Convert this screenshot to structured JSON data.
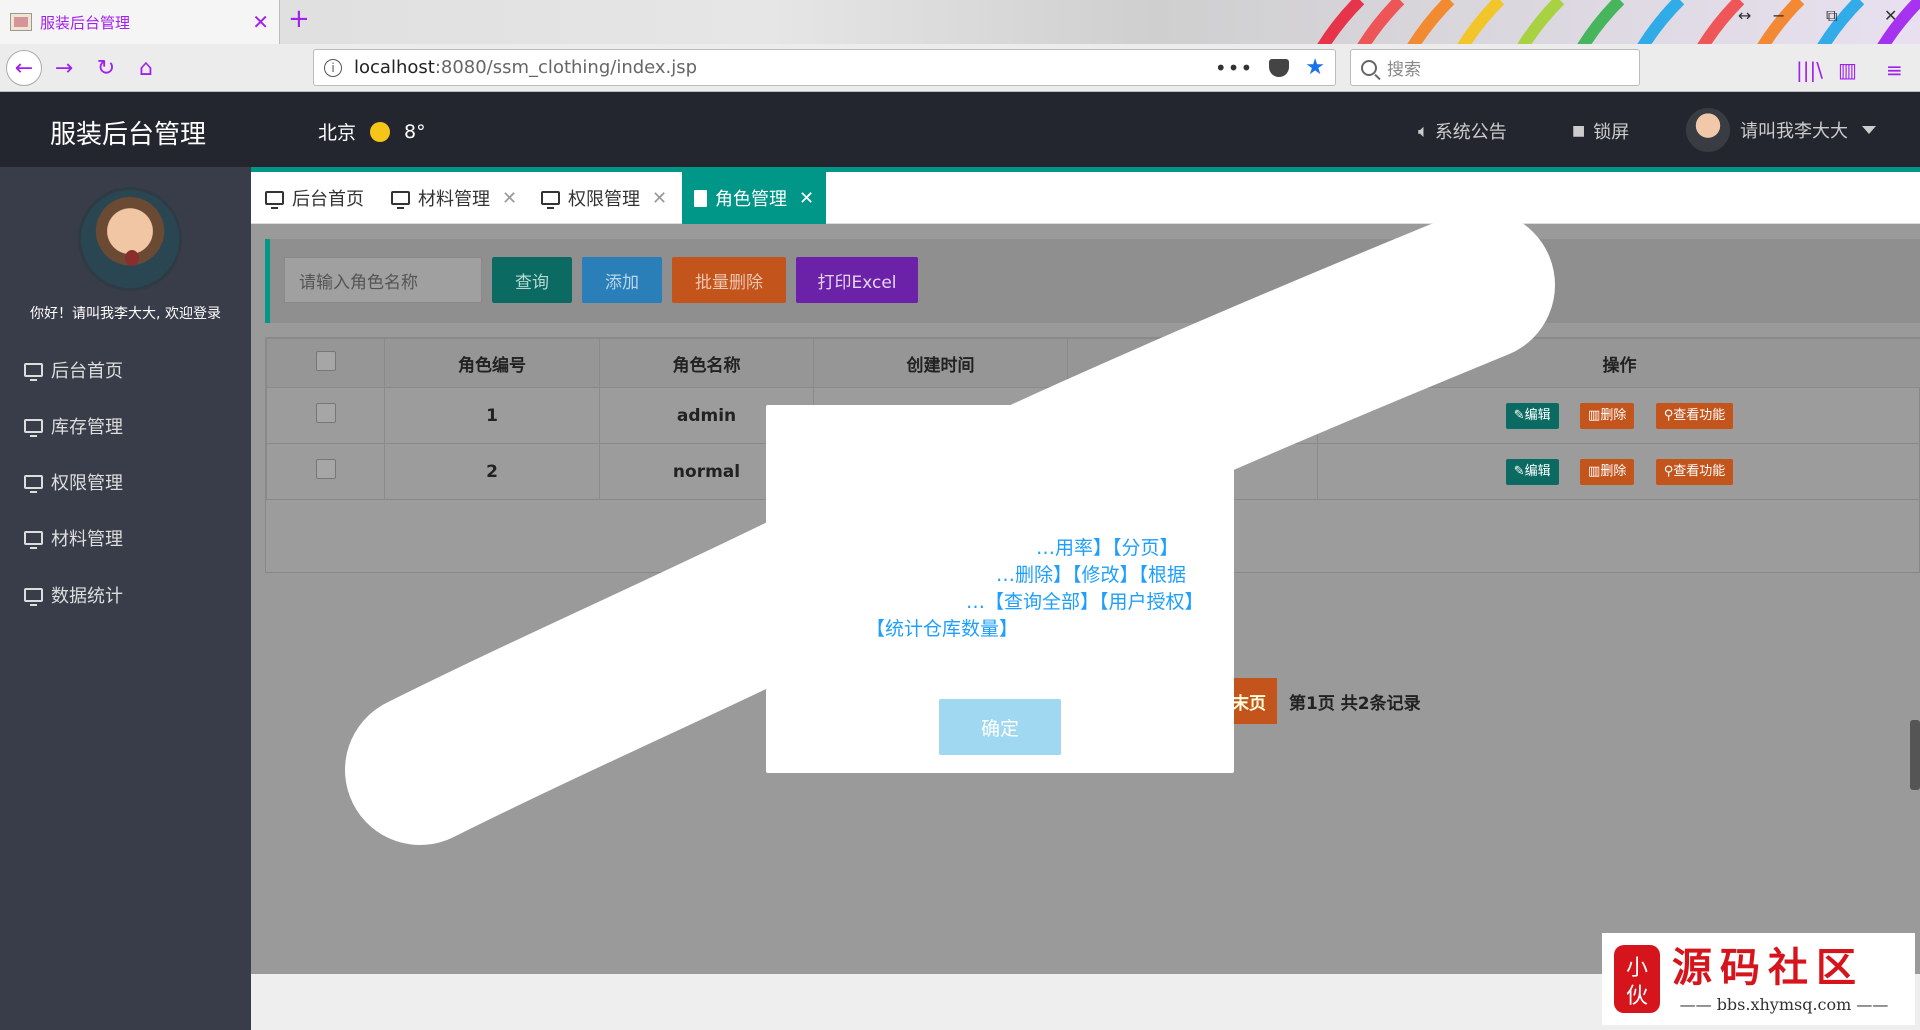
{
  "browser": {
    "tab_title": "服装后台管理",
    "tab_close": "✕",
    "new_tab": "+",
    "url_host": "localhost",
    "url_path": ":8080/ssm_clothing/index.jsp",
    "url_more": "•••",
    "search_placeholder": "搜索",
    "win_restore": "↔",
    "win_min": "−",
    "win_max": "⧉",
    "win_close": "✕"
  },
  "header": {
    "logo": "服装后台管理",
    "city": "北京",
    "temperature": "8°",
    "notice": "系统公告",
    "lock": "锁屏",
    "username": "请叫我李大大"
  },
  "sidebar": {
    "welcome": "你好！请叫我李大大, 欢迎登录",
    "items": [
      {
        "label": "后台首页"
      },
      {
        "label": "库存管理"
      },
      {
        "label": "权限管理"
      },
      {
        "label": "材料管理"
      },
      {
        "label": "数据统计"
      }
    ]
  },
  "tabs": [
    {
      "label": "后台首页"
    },
    {
      "label": "材料管理"
    },
    {
      "label": "权限管理"
    },
    {
      "label": "角色管理"
    }
  ],
  "toolbar": {
    "search_placeholder": "请输入角色名称",
    "query": "查询",
    "add": "添加",
    "batch_delete": "批量删除",
    "print_excel": "打印Excel"
  },
  "table": {
    "headers": [
      "角色编号",
      "角色名称",
      "创建时间",
      "操作"
    ],
    "rows": [
      {
        "id": "1",
        "name": "admin"
      },
      {
        "id": "2",
        "name": "normal"
      }
    ],
    "ops": {
      "edit": "编辑",
      "delete": "删除",
      "view": "查看功能"
    }
  },
  "pager": {
    "last": "末页",
    "info": "第1页 共2条记录"
  },
  "modal": {
    "lines": [
      "…用率】【分页】",
      "…删除】【修改】【根据",
      "…【查询全部】【用户授权】",
      "【统计仓库数量】"
    ],
    "ok": "确定"
  },
  "watermark": {
    "title": "源码社区",
    "url": "bbs.xhymsq.com",
    "seal": "小伙"
  },
  "colors": {
    "teal": "#009688",
    "blue": "#1e9fff",
    "orange": "#ff5722",
    "purple": "#7c3aed",
    "header_bg": "#23262e",
    "sidebar_bg": "#393d49"
  }
}
